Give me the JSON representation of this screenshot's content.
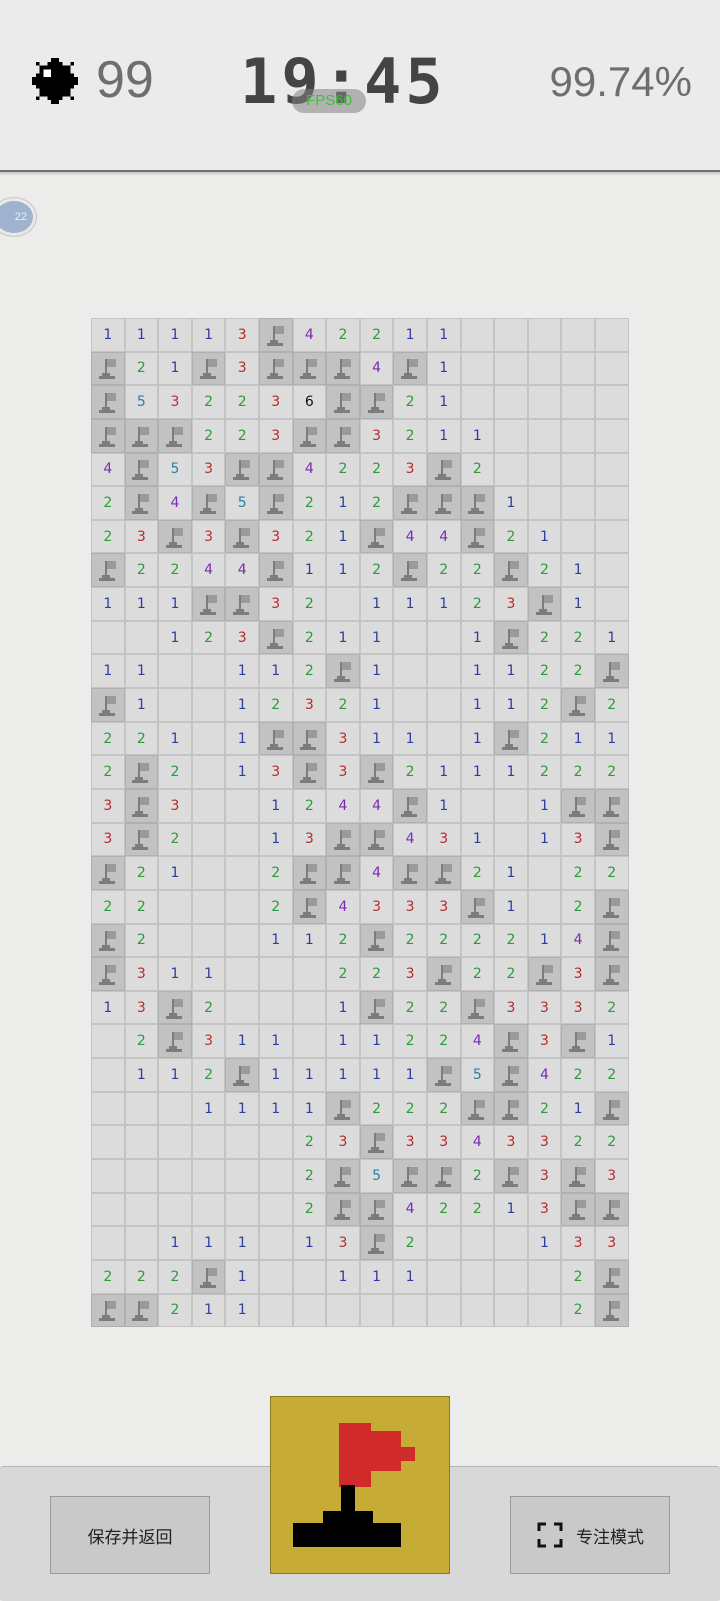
{
  "header": {
    "mines_remaining": "99",
    "timer": "19:45",
    "fps": "FPS60",
    "progress": "99.74%",
    "avatar_text": "22"
  },
  "board": {
    "rows": [
      [
        "1",
        "1",
        "1",
        "1",
        "3",
        "F",
        "4",
        "2",
        "2",
        "1",
        "1",
        "",
        "",
        "",
        "",
        ""
      ],
      [
        "F",
        "2",
        "1",
        "F",
        "3",
        "F",
        "F",
        "F",
        "4",
        "F",
        "1",
        "",
        "",
        "",
        "",
        ""
      ],
      [
        "F",
        "5",
        "3",
        "2",
        "2",
        "3",
        "6",
        "F",
        "F",
        "2",
        "1",
        "",
        "",
        "",
        "",
        ""
      ],
      [
        "F",
        "F",
        "F",
        "2",
        "2",
        "3",
        "F",
        "F",
        "3",
        "2",
        "1",
        "1",
        "",
        "",
        "",
        ""
      ],
      [
        "4",
        "F",
        "5",
        "3",
        "F",
        "F",
        "4",
        "2",
        "2",
        "3",
        "F",
        "2",
        "",
        "",
        "",
        ""
      ],
      [
        "2",
        "F",
        "4",
        "F",
        "5",
        "F",
        "2",
        "1",
        "2",
        "F",
        "F",
        "F",
        "1",
        "",
        "",
        ""
      ],
      [
        "2",
        "3",
        "F",
        "3",
        "F",
        "3",
        "2",
        "1",
        "F",
        "4",
        "4",
        "F",
        "2",
        "1",
        "",
        ""
      ],
      [
        "F",
        "2",
        "2",
        "4",
        "4",
        "F",
        "1",
        "1",
        "2",
        "F",
        "2",
        "2",
        "F",
        "2",
        "1",
        ""
      ],
      [
        "1",
        "1",
        "1",
        "F",
        "F",
        "3",
        "2",
        "",
        "1",
        "1",
        "1",
        "2",
        "3",
        "F",
        "1",
        ""
      ],
      [
        "",
        "",
        "1",
        "2",
        "3",
        "F",
        "2",
        "1",
        "1",
        "",
        "",
        "1",
        "F",
        "2",
        "2",
        "1"
      ],
      [
        "1",
        "1",
        "",
        "",
        "1",
        "1",
        "2",
        "F",
        "1",
        "",
        "",
        "1",
        "1",
        "2",
        "2",
        "F"
      ],
      [
        "F",
        "1",
        "",
        "",
        "1",
        "2",
        "3",
        "2",
        "1",
        "",
        "",
        "1",
        "1",
        "2",
        "F",
        "2"
      ],
      [
        "2",
        "2",
        "1",
        "",
        "1",
        "F",
        "F",
        "3",
        "1",
        "1",
        "",
        "1",
        "F",
        "2",
        "1",
        "1"
      ],
      [
        "2",
        "F",
        "2",
        "",
        "1",
        "3",
        "F",
        "3",
        "F",
        "2",
        "1",
        "1",
        "1",
        "2",
        "2",
        "2"
      ],
      [
        "3",
        "F",
        "3",
        "",
        "",
        "1",
        "2",
        "4",
        "4",
        "F",
        "1",
        "",
        "",
        "1",
        "F",
        "F"
      ],
      [
        "3",
        "F",
        "2",
        "",
        "",
        "1",
        "3",
        "F",
        "F",
        "4",
        "3",
        "1",
        "",
        "1",
        "3",
        "F"
      ],
      [
        "F",
        "2",
        "1",
        "",
        "",
        "2",
        "F",
        "F",
        "4",
        "F",
        "F",
        "2",
        "1",
        "",
        "2",
        "2"
      ],
      [
        "2",
        "2",
        "",
        "",
        "",
        "2",
        "F",
        "4",
        "3",
        "3",
        "3",
        "F",
        "1",
        "",
        "2",
        "F"
      ],
      [
        "F",
        "2",
        "",
        "",
        "",
        "1",
        "1",
        "2",
        "F",
        "2",
        "2",
        "2",
        "2",
        "1",
        "4",
        "F"
      ],
      [
        "F",
        "3",
        "1",
        "1",
        "",
        "",
        "",
        "2",
        "2",
        "3",
        "F",
        "2",
        "2",
        "F",
        "3",
        "F"
      ],
      [
        "1",
        "3",
        "F",
        "2",
        "",
        "",
        "",
        "1",
        "F",
        "2",
        "2",
        "F",
        "3",
        "3",
        "3",
        "2"
      ],
      [
        "",
        "2",
        "F",
        "3",
        "1",
        "1",
        "",
        "1",
        "1",
        "2",
        "2",
        "4",
        "F",
        "3",
        "F",
        "1"
      ],
      [
        "",
        "1",
        "1",
        "2",
        "F",
        "1",
        "1",
        "1",
        "1",
        "1",
        "F",
        "5",
        "F",
        "4",
        "2",
        "2"
      ],
      [
        "",
        "",
        "",
        "1",
        "1",
        "1",
        "1",
        "F",
        "2",
        "2",
        "2",
        "F",
        "F",
        "2",
        "1",
        "F"
      ],
      [
        "",
        "",
        "",
        "",
        "",
        "",
        "2",
        "3",
        "F",
        "3",
        "3",
        "4",
        "3",
        "3",
        "2",
        "2"
      ],
      [
        "",
        "",
        "",
        "",
        "",
        "",
        "2",
        "F",
        "5",
        "F",
        "F",
        "2",
        "F",
        "3",
        "F",
        "3"
      ],
      [
        "",
        "",
        "",
        "",
        "",
        "",
        "2",
        "F",
        "F",
        "4",
        "2",
        "2",
        "1",
        "3",
        "F",
        "F"
      ],
      [
        "",
        "",
        "1",
        "1",
        "1",
        "",
        "1",
        "3",
        "F",
        "2",
        "",
        "",
        "",
        "1",
        "3",
        "3"
      ],
      [
        "2",
        "2",
        "2",
        "F",
        "1",
        "",
        "",
        "1",
        "1",
        "1",
        "",
        "",
        "",
        "",
        "2",
        "F"
      ],
      [
        "F",
        "F",
        "2",
        "1",
        "1",
        "",
        "",
        "",
        "",
        "",
        "",
        "",
        "",
        "",
        "2",
        "F"
      ]
    ]
  },
  "colors": {
    "1": "#2f3e9e",
    "2": "#2e9a3a",
    "3": "#b62b2b",
    "4": "#7a2ab6",
    "5": "#2a7fa6",
    "6": "#111111",
    "mode_button_bg": "#c6ab36",
    "flag_red": "#d02a2a"
  },
  "icons": {
    "flag": "flag-icon",
    "mine": "mine-icon",
    "focus": "focus-frame-icon"
  },
  "footer": {
    "save_label": "保存并返回",
    "focus_label": "专注模式",
    "mode": "flag"
  }
}
